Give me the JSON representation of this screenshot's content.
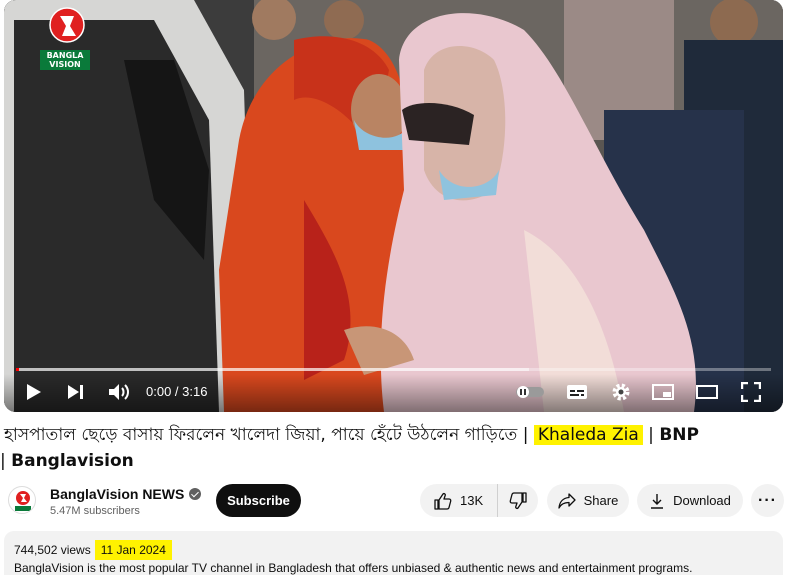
{
  "player": {
    "logo_text": "BANGLA VISION",
    "time_display": "0:00 / 3:16",
    "progress": 0.004,
    "buffered": 0.68,
    "controls": [
      "play-icon",
      "next-icon",
      "volume-icon",
      "autoplay-toggle-icon",
      "subtitles-icon",
      "settings-icon",
      "miniplayer-icon",
      "theater-icon",
      "fullscreen-icon"
    ]
  },
  "video": {
    "title_bengali": "হাসপাতাল ছেড়ে বাসায় ফিরলেন খালেদা জিয়া, পায়ে হেঁটে উঠলেন গাড়িতে",
    "sep1": " | ",
    "highlight_tag": "Khaleda Zia",
    "sep2": " | ",
    "tag2": "BNP",
    "sep3": " | ",
    "tag3": "Banglavision"
  },
  "channel": {
    "name": "BanglaVision NEWS",
    "subscribers": "5.47M subscribers",
    "subscribe_label": "Subscribe"
  },
  "actions": {
    "like_count": "13K",
    "share_label": "Share",
    "download_label": "Download",
    "more_label": "···"
  },
  "description": {
    "views": "744,502 views",
    "date": "11 Jan 2024",
    "text": "BanglaVision is the most popular TV channel in Bangladesh that offers unbiased & authentic news and entertainment programs."
  },
  "colors": {
    "highlight": "#fff200",
    "progress_red": "#ff0000",
    "brand_green": "#0a7a3a",
    "logo_red": "#e02020"
  }
}
